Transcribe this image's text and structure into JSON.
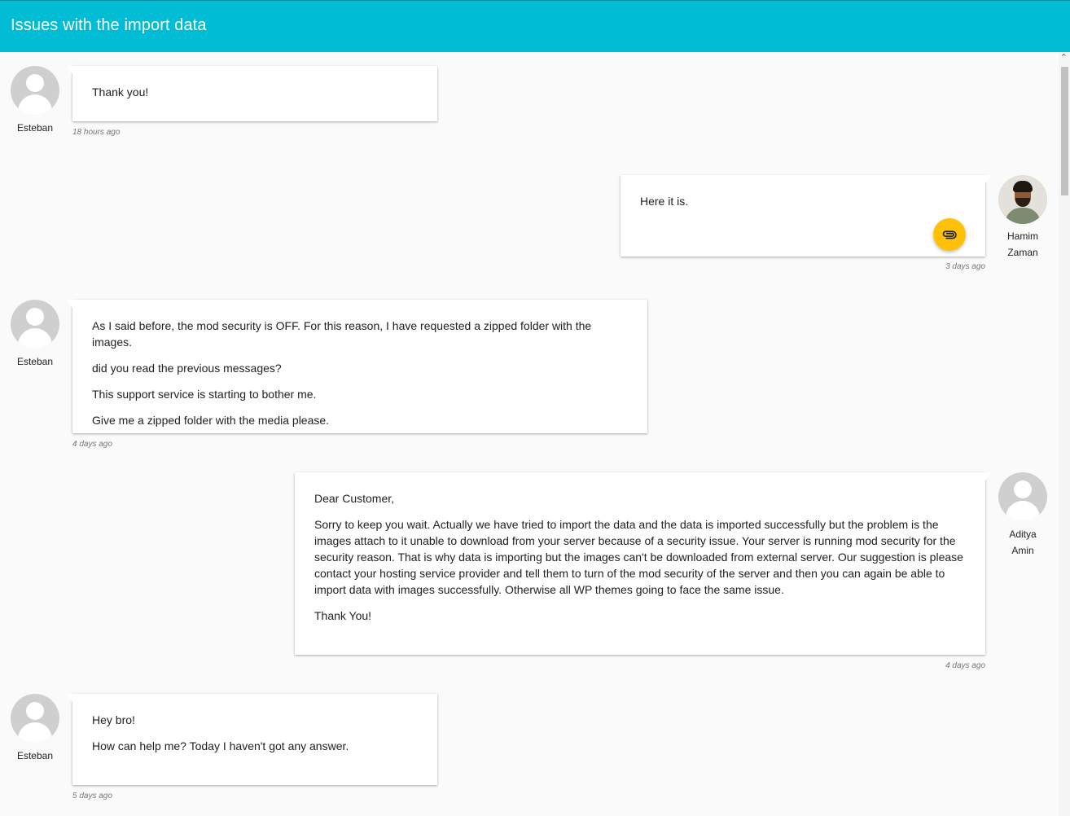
{
  "header": {
    "title": "Issues with the import data",
    "color": "#00bcd4"
  },
  "messages": [
    {
      "author": "Esteban",
      "side": "left",
      "paragraphs": [
        "Thank you!"
      ],
      "time": "18 hours ago"
    },
    {
      "author_line1": "Hamim",
      "author_line2": "Zaman",
      "side": "right",
      "paragraphs": [
        "Here it is."
      ],
      "attachment_icon": "paperclip-icon",
      "attachment_color": "#ffc107",
      "time": "3 days ago"
    },
    {
      "author": "Esteban",
      "side": "left",
      "paragraphs": [
        "As I said before, the mod security is OFF. For this reason, I have requested a zipped folder with the images.",
        "did you read the previous messages?",
        "This support service is starting to bother me.",
        "Give me a zipped folder with the media please."
      ],
      "time": "4 days ago"
    },
    {
      "author_line1": "Aditya",
      "author_line2": "Amin",
      "side": "right",
      "paragraphs": [
        "Dear Customer,",
        "Sorry to keep you wait. Actually we have tried to import the data and the data is imported successfully but the problem is the images attach to it unable to download from your server because of a security issue. Your server is running mod security for the security reason. That is why data is importing but the images can't be downloaded from external server. Our suggestion is please contact your hosting service provider and tell them to turn of the mod security of the server and then you can again be able to import data with images successfully. Otherwise all WP themes going to face the same issue.",
        "Thank You!"
      ],
      "time": "4 days ago"
    },
    {
      "author": "Esteban",
      "side": "left",
      "paragraphs": [
        "Hey bro!",
        "How can help me? Today I haven't got any answer."
      ],
      "time": "5 days ago"
    }
  ]
}
